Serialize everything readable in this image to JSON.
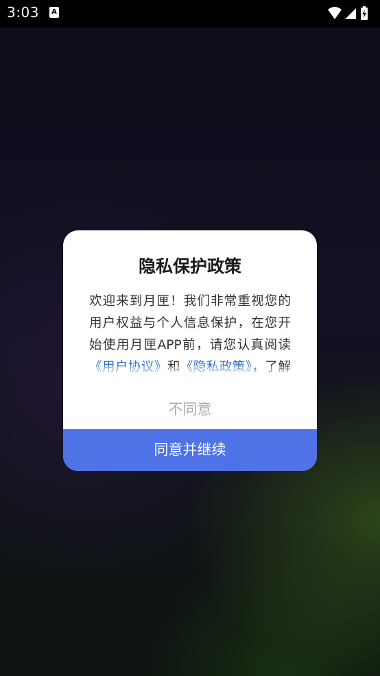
{
  "status_bar": {
    "time": "3:03",
    "notification_icon": "A",
    "icons": [
      "wifi-icon",
      "cellular-signal-icon",
      "battery-charging-icon"
    ]
  },
  "dialog": {
    "title": "隐私保护政策",
    "body": {
      "text_1": "欢迎来到月匣！我们非常重视您的用户权益与个人信息保护，在您开始使用月匣APP前，请您认真阅读",
      "link_user_agreement": "《用户协议》",
      "text_2": "和",
      "link_privacy_policy": "《隐私政策》",
      "text_3": "，了解我们如何收集、处理"
    },
    "disagree_label": "不同意",
    "agree_label": "同意并继续"
  },
  "colors": {
    "accent": "#4f72e6",
    "link": "#2f6fd1",
    "disagree_text": "#aaaaaa",
    "title_text": "#1a1a1a"
  }
}
